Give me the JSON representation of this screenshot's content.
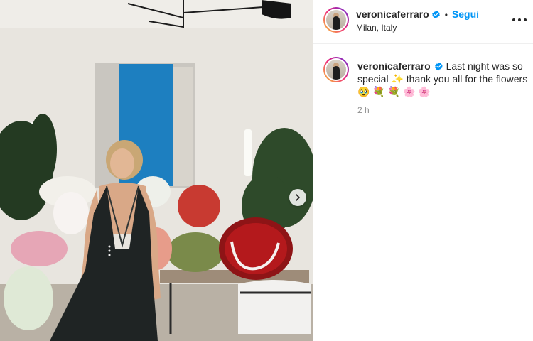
{
  "post": {
    "image_alt": "Woman in black velvet halter jumpsuit posing in a room full of flower bouquets",
    "has_next_button": true
  },
  "header": {
    "username": "veronicaferraro",
    "verified": true,
    "separator": "•",
    "follow_label": "Segui",
    "location": "Milan, Italy"
  },
  "caption": {
    "username": "veronicaferraro",
    "text": "Last night was so special ✨ thank you all for the flowers 🥹 💐 💐 🌸 🌸"
  },
  "meta": {
    "time_ago": "2 h"
  },
  "colors": {
    "follow": "#0095f6",
    "verified": "#0095f6",
    "muted_text": "#8e8e8e"
  },
  "icons": [
    "verified-badge-icon",
    "more-options-icon",
    "chevron-right-icon"
  ]
}
